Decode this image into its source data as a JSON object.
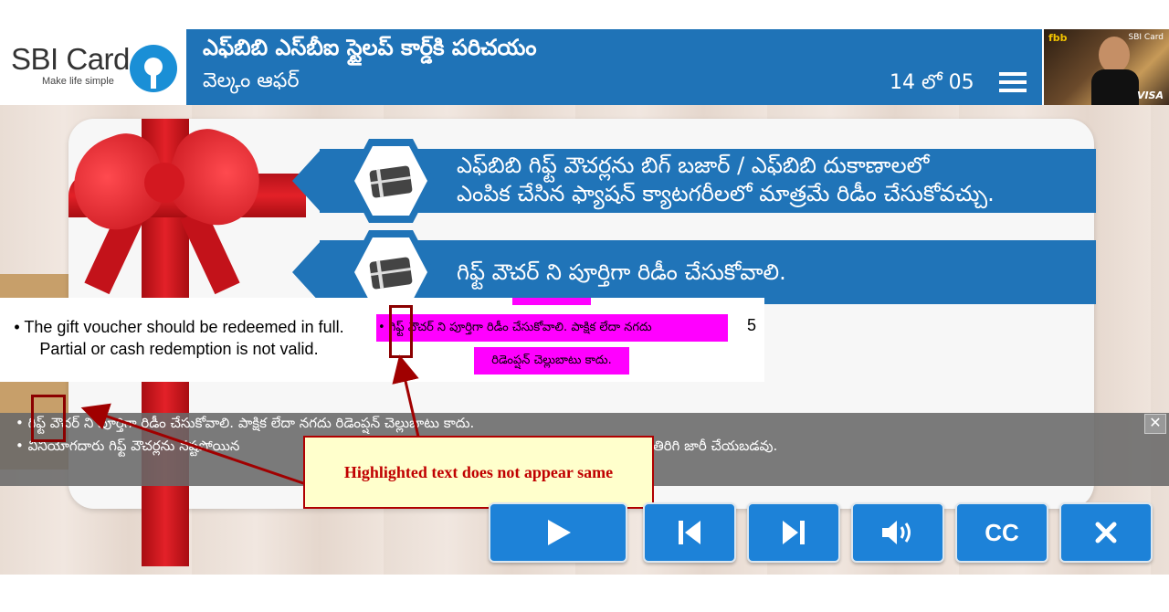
{
  "header": {
    "logo_text": "SBI Card",
    "logo_tagline": "Make life simple",
    "course_title": "ఎఫ్‌బిబి ఎస్‌బీఐ స్టైలప్ కార్డ్‌కి పరిచయం",
    "section_title": "వెల్కం ఆఫర్",
    "page_counter": "14 లో 05",
    "menu_icon": "hamburger-menu-icon",
    "card_thumb_brand": "fbb",
    "card_thumb_issuer": "SBI Card",
    "card_thumb_network": "VISA"
  },
  "slide": {
    "banner_1": {
      "line1": "ఎఫ్‌బిబి గిఫ్ట్ వౌచర్లను బిగ్ బజార్ / ఎఫ్‌బిబి దుకాణాలలో",
      "line2": "ఎంపిక చేసిన ఫ్యాషన్ క్యాటగరీలలో మాత్రమే రిడీం చేసుకోవచ్చు.",
      "icon": "gift-card-icon"
    },
    "banner_2": {
      "line1": "గిఫ్ట్ వౌచర్ ని పూర్తిగా రిడీం చేసుకోవాలి.",
      "icon": "gift-card-icon"
    }
  },
  "annotation": {
    "english_text": "• The gift voucher should be redeemed in full. Partial or cash redemption is not valid.",
    "telugu_line1": "• గిఫ్ట్ వౌచర్ ని పూర్తిగా రిడీం చేసుకోవాలి. పాక్షిక లేదా నగదు",
    "telugu_line2": "రిడెంప్షన్ చెల్లుబాటు కాదు.",
    "row_number": "5",
    "callout": "Highlighted text does not appear same"
  },
  "captions": {
    "line1": "• గిఫ్ట్ వౌచర్ ని పూర్తిగా రిడీం చేసుకోవాలి. పాక్షిక లేదా నగదు రిడెంప్షన్ చెల్లుబాటు కాదు.",
    "line2_start": "• వినియోగదారు గిఫ్ట్ వౌచర్లను నష్టపోయిన",
    "line2_end": "తిరిగి జారీ చేయబడవు.",
    "close_label": "✕"
  },
  "controls": {
    "play": "play-icon",
    "previous": "previous-icon",
    "next": "next-icon",
    "audio": "volume-icon",
    "cc_label": "CC",
    "close": "close-icon"
  },
  "colors": {
    "header_blue": "#1f73b7",
    "banner_blue": "#2074b8",
    "button_blue": "#1d82d8",
    "highlight_magenta": "#ff00ff",
    "annotation_red": "#c00000",
    "callout_bg": "#ffffcc"
  }
}
